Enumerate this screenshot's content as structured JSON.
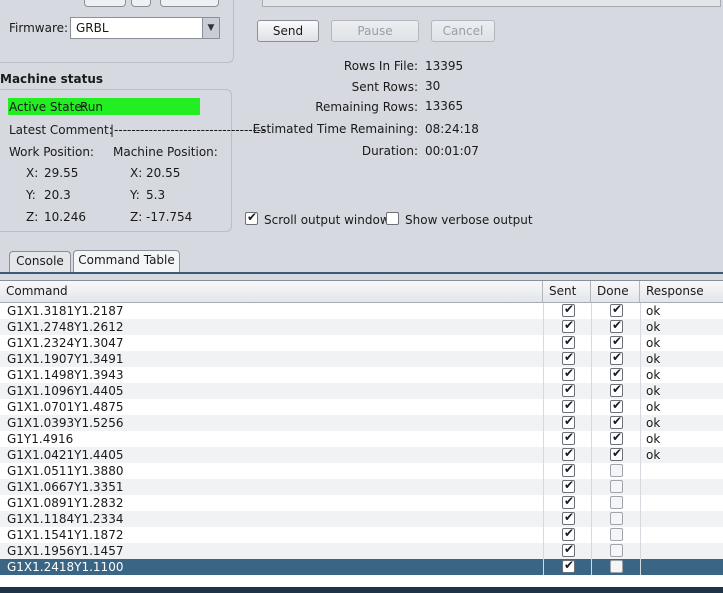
{
  "firmware": {
    "label": "Firmware:",
    "selected": "GRBL"
  },
  "controls": {
    "send": "Send",
    "pause": "Pause",
    "cancel": "Cancel"
  },
  "machine_status": {
    "title": "Machine status",
    "active_state_label": "Active State:",
    "active_state_value": "Run",
    "latest_comment_label": "Latest Comment:",
    "latest_comment_value": "|-----------------------------------",
    "work_position_label": "Work Position:",
    "machine_position_label": "Machine Position:",
    "work": {
      "x_label": "X:",
      "x": "29.55",
      "y_label": "Y:",
      "y": "20.3",
      "z_label": "Z:",
      "z": "10.246"
    },
    "machine": {
      "x_label": "X:",
      "x": "20.55",
      "y_label": "Y:",
      "y": "5.3",
      "z_label": "Z:",
      "z": "-17.754"
    }
  },
  "stats": {
    "rows_in_file_label": "Rows In File:",
    "rows_in_file": "13395",
    "sent_rows_label": "Sent Rows:",
    "sent_rows": "30",
    "remaining_rows_label": "Remaining Rows:",
    "remaining_rows": "13365",
    "est_time_label": "Estimated Time Remaining:",
    "est_time": "08:24:18",
    "duration_label": "Duration:",
    "duration": "00:01:07"
  },
  "options": {
    "scroll_output": {
      "label": "Scroll output window",
      "checked": true
    },
    "verbose_output": {
      "label": "Show verbose output",
      "checked": false
    }
  },
  "tabs": [
    {
      "label": "Console",
      "active": false
    },
    {
      "label": "Command Table",
      "active": true
    }
  ],
  "table": {
    "headers": {
      "command": "Command",
      "sent": "Sent",
      "done": "Done",
      "response": "Response"
    },
    "rows": [
      {
        "command": "G1X1.3181Y1.2187",
        "sent": true,
        "done": true,
        "response": "ok"
      },
      {
        "command": "G1X1.2748Y1.2612",
        "sent": true,
        "done": true,
        "response": "ok"
      },
      {
        "command": "G1X1.2324Y1.3047",
        "sent": true,
        "done": true,
        "response": "ok"
      },
      {
        "command": "G1X1.1907Y1.3491",
        "sent": true,
        "done": true,
        "response": "ok"
      },
      {
        "command": "G1X1.1498Y1.3943",
        "sent": true,
        "done": true,
        "response": "ok"
      },
      {
        "command": "G1X1.1096Y1.4405",
        "sent": true,
        "done": true,
        "response": "ok"
      },
      {
        "command": "G1X1.0701Y1.4875",
        "sent": true,
        "done": true,
        "response": "ok"
      },
      {
        "command": "G1X1.0393Y1.5256",
        "sent": true,
        "done": true,
        "response": "ok"
      },
      {
        "command": "G1Y1.4916",
        "sent": true,
        "done": true,
        "response": "ok"
      },
      {
        "command": "G1X1.0421Y1.4405",
        "sent": true,
        "done": true,
        "response": "ok"
      },
      {
        "command": "G1X1.0511Y1.3880",
        "sent": true,
        "done": false,
        "response": ""
      },
      {
        "command": "G1X1.0667Y1.3351",
        "sent": true,
        "done": false,
        "response": ""
      },
      {
        "command": "G1X1.0891Y1.2832",
        "sent": true,
        "done": false,
        "response": ""
      },
      {
        "command": "G1X1.1184Y1.2334",
        "sent": true,
        "done": false,
        "response": ""
      },
      {
        "command": "G1X1.1541Y1.1872",
        "sent": true,
        "done": false,
        "response": ""
      },
      {
        "command": "G1X1.1956Y1.1457",
        "sent": true,
        "done": false,
        "response": ""
      },
      {
        "command": "G1X1.2418Y1.1100",
        "sent": true,
        "done": false,
        "response": "",
        "selected": true
      }
    ]
  },
  "colors": {
    "active_state_bg": "#22ee22",
    "selection": "#3b6585",
    "tab_line": "#3c5a74"
  },
  "icons": {
    "dropdown": "chevron-down-icon",
    "check": "checkmark-icon"
  }
}
